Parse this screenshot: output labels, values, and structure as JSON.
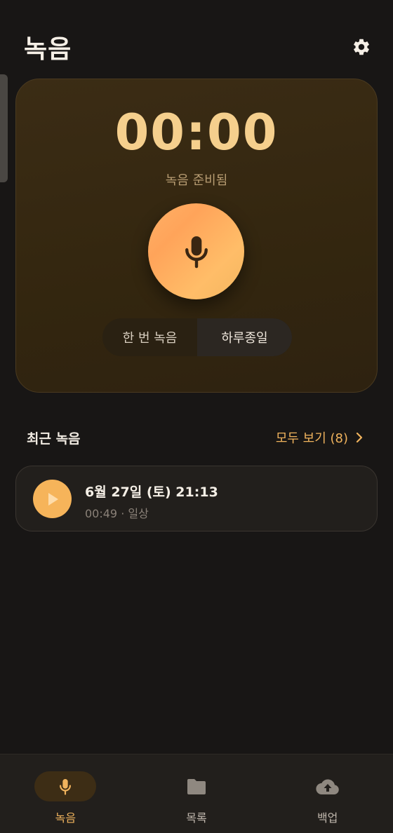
{
  "header": {
    "title": "녹음",
    "settings_icon": "gear-icon"
  },
  "recorder": {
    "timer": "00:00",
    "status": "녹음 준비됨",
    "mic_icon": "microphone-icon",
    "modes": [
      {
        "label": "한 번 녹음",
        "active": false
      },
      {
        "label": "하루종일",
        "active": true
      }
    ]
  },
  "recent": {
    "title": "최근 녹음",
    "see_all": "모두 보기 (8)",
    "items": [
      {
        "title": "6월 27일 (토) 21:13",
        "meta": "00:49 · 일상"
      }
    ]
  },
  "nav": {
    "items": [
      {
        "label": "녹음",
        "icon": "microphone-icon",
        "active": true
      },
      {
        "label": "목록",
        "icon": "folder-icon",
        "active": false
      },
      {
        "label": "백업",
        "icon": "cloud-upload-icon",
        "active": false
      }
    ]
  },
  "colors": {
    "background": "#181615",
    "accent": "#f0b35d",
    "timer": "#f5cf8d",
    "card": "#33260f"
  }
}
